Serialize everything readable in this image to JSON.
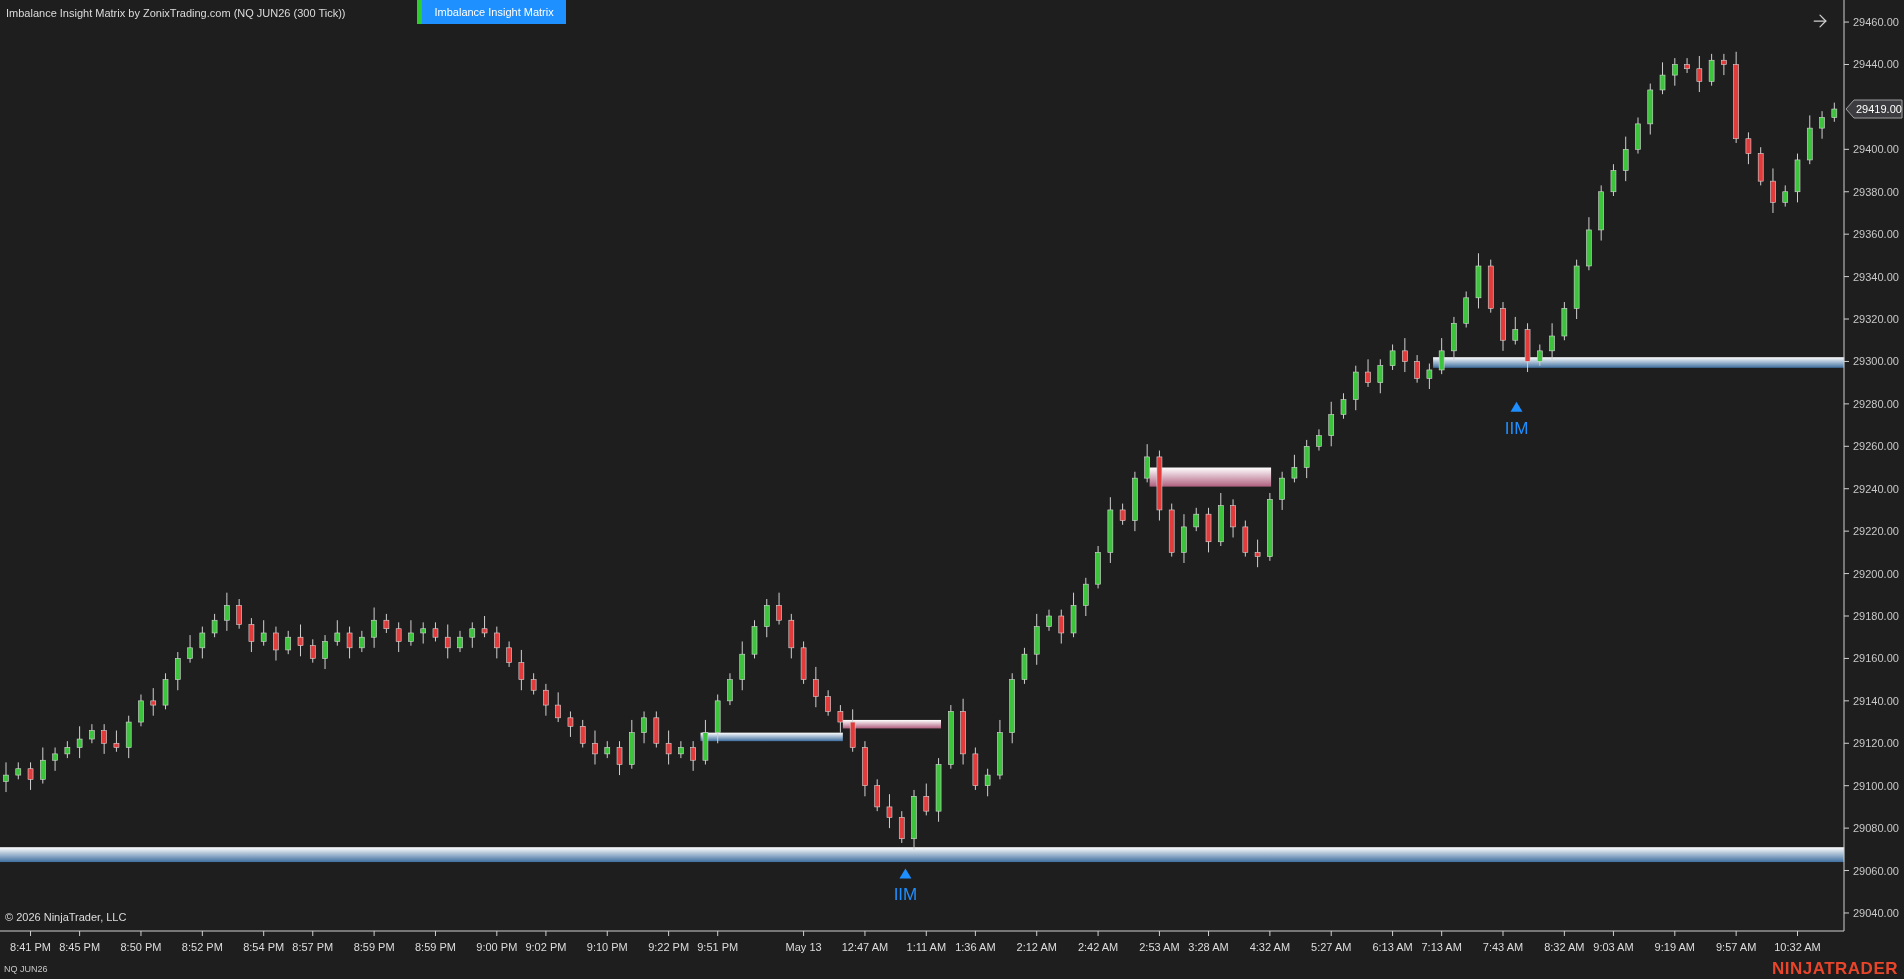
{
  "header": {
    "title": "Imbalance Insight Matrix by ZonixTrading.com (NQ JUN26 (300 Tick))",
    "indicator_button": "Imbalance Insight Matrix"
  },
  "chart": {
    "current_price": "29419.00",
    "copyright": "© 2026 NinjaTrader, LLC",
    "zones": [
      {
        "kind": "bullish"
      },
      {
        "kind": "bullish"
      },
      {
        "kind": "bearish"
      },
      {
        "kind": "bearish"
      },
      {
        "kind": "bullish"
      }
    ],
    "markers": [
      {
        "label": "IIM"
      },
      {
        "label": "IIM"
      }
    ],
    "chart_data": {
      "type": "candlestick",
      "ylim": [
        29031.5,
        29470.4
      ],
      "categories": [
        null,
        null,
        "8:41 PM",
        null,
        null,
        null,
        "8:45 PM",
        null,
        null,
        null,
        null,
        "8:50 PM",
        null,
        null,
        null,
        null,
        "8:52 PM",
        null,
        null,
        null,
        null,
        "8:54 PM",
        null,
        null,
        null,
        "8:57 PM",
        null,
        null,
        null,
        null,
        "8:59 PM",
        null,
        null,
        null,
        null,
        "8:59 PM",
        null,
        null,
        null,
        null,
        "9:00 PM",
        null,
        null,
        null,
        "9:02 PM",
        null,
        null,
        null,
        null,
        "9:10 PM",
        null,
        null,
        null,
        null,
        "9:22 PM",
        null,
        null,
        null,
        "9:51 PM",
        null,
        null,
        null,
        null,
        null,
        null,
        "May 13",
        null,
        null,
        null,
        null,
        "12:47 AM",
        null,
        null,
        null,
        null,
        "1:11 AM",
        null,
        null,
        null,
        "1:36 AM",
        null,
        null,
        null,
        null,
        "2:12 AM",
        null,
        null,
        null,
        null,
        "2:42 AM",
        null,
        null,
        null,
        null,
        "2:53 AM",
        null,
        null,
        null,
        "3:28 AM",
        null,
        null,
        null,
        null,
        "4:32 AM",
        null,
        null,
        null,
        null,
        "5:27 AM",
        null,
        null,
        null,
        null,
        "6:13 AM",
        null,
        null,
        null,
        "7:13 AM",
        null,
        null,
        null,
        null,
        "7:43 AM",
        null,
        null,
        null,
        null,
        "8:32 AM",
        null,
        null,
        null,
        "9:03 AM",
        null,
        null,
        null,
        null,
        "9:19 AM",
        null,
        null,
        null,
        null,
        "9:57 AM",
        null,
        null,
        null,
        null,
        "10:32 AM",
        null,
        null,
        null
      ],
      "ohlc": [
        [
          29102,
          29111,
          29097,
          29105
        ],
        [
          29105,
          29111,
          29103,
          29108
        ],
        [
          29108,
          29111,
          29098,
          29103
        ],
        [
          29103,
          29118,
          29101,
          29112
        ],
        [
          29112,
          29118,
          29107,
          29115
        ],
        [
          29115,
          29121,
          29113,
          29118
        ],
        [
          29118,
          29128,
          29113,
          29122
        ],
        [
          29122,
          29129,
          29120,
          29126
        ],
        [
          29126,
          29129,
          29115,
          29120
        ],
        [
          29120,
          29126,
          29116,
          29118
        ],
        [
          29118,
          29133,
          29113,
          29130
        ],
        [
          29130,
          29143,
          29128,
          29140
        ],
        [
          29140,
          29146,
          29133,
          29138
        ],
        [
          29138,
          29153,
          29136,
          29150
        ],
        [
          29150,
          29163,
          29145,
          29160
        ],
        [
          29160,
          29171,
          29158,
          29165
        ],
        [
          29165,
          29175,
          29160,
          29172
        ],
        [
          29172,
          29181,
          29170,
          29178
        ],
        [
          29178,
          29191,
          29173,
          29185
        ],
        [
          29185,
          29188,
          29174,
          29176
        ],
        [
          29176,
          29179,
          29163,
          29168
        ],
        [
          29168,
          29178,
          29166,
          29172
        ],
        [
          29172,
          29175,
          29159,
          29164
        ],
        [
          29164,
          29173,
          29162,
          29170
        ],
        [
          29170,
          29176,
          29161,
          29166
        ],
        [
          29166,
          29169,
          29158,
          29160
        ],
        [
          29160,
          29171,
          29155,
          29168
        ],
        [
          29168,
          29178,
          29166,
          29172
        ],
        [
          29172,
          29175,
          29160,
          29165
        ],
        [
          29165,
          29173,
          29163,
          29170
        ],
        [
          29170,
          29184,
          29165,
          29178
        ],
        [
          29178,
          29181,
          29172,
          29174
        ],
        [
          29174,
          29177,
          29163,
          29168
        ],
        [
          29168,
          29178,
          29166,
          29172
        ],
        [
          29172,
          29177,
          29167,
          29174
        ],
        [
          29174,
          29177,
          29168,
          29170
        ],
        [
          29170,
          29176,
          29160,
          29165
        ],
        [
          29165,
          29173,
          29163,
          29170
        ],
        [
          29170,
          29177,
          29165,
          29174
        ],
        [
          29174,
          29180,
          29170,
          29172
        ],
        [
          29172,
          29175,
          29160,
          29165
        ],
        [
          29165,
          29168,
          29156,
          29158
        ],
        [
          29158,
          29164,
          29145,
          29150
        ],
        [
          29150,
          29153,
          29143,
          29145
        ],
        [
          29145,
          29148,
          29133,
          29138
        ],
        [
          29138,
          29144,
          29130,
          29132
        ],
        [
          29132,
          29135,
          29123,
          29128
        ],
        [
          29128,
          29131,
          29118,
          29120
        ],
        [
          29120,
          29126,
          29110,
          29115
        ],
        [
          29115,
          29121,
          29113,
          29118
        ],
        [
          29118,
          29121,
          29105,
          29110
        ],
        [
          29110,
          29131,
          29108,
          29125
        ],
        [
          29125,
          29135,
          29120,
          29132
        ],
        [
          29132,
          29135,
          29118,
          29120
        ],
        [
          29120,
          29126,
          29110,
          29115
        ],
        [
          29115,
          29121,
          29113,
          29118
        ],
        [
          29118,
          29121,
          29107,
          29112
        ],
        [
          29112,
          29131,
          29110,
          29125
        ],
        [
          29125,
          29143,
          29120,
          29140
        ],
        [
          29140,
          29153,
          29138,
          29150
        ],
        [
          29150,
          29168,
          29145,
          29162
        ],
        [
          29162,
          29178,
          29160,
          29175
        ],
        [
          29175,
          29188,
          29170,
          29185
        ],
        [
          29185,
          29191,
          29176,
          29178
        ],
        [
          29178,
          29181,
          29160,
          29165
        ],
        [
          29165,
          29168,
          29148,
          29150
        ],
        [
          29150,
          29156,
          29137,
          29142
        ],
        [
          29142,
          29145,
          29133,
          29135
        ],
        [
          29135,
          29138,
          29125,
          29130
        ],
        [
          29130,
          29136,
          29116,
          29118
        ],
        [
          29118,
          29121,
          29095,
          29100
        ],
        [
          29100,
          29103,
          29088,
          29090
        ],
        [
          29090,
          29096,
          29080,
          29085
        ],
        [
          29085,
          29088,
          29073,
          29075
        ],
        [
          29075,
          29098,
          29070,
          29095
        ],
        [
          29095,
          29101,
          29086,
          29088
        ],
        [
          29088,
          29113,
          29083,
          29110
        ],
        [
          29110,
          29138,
          29108,
          29135
        ],
        [
          29135,
          29141,
          29110,
          29115
        ],
        [
          29115,
          29118,
          29098,
          29100
        ],
        [
          29100,
          29108,
          29095,
          29105
        ],
        [
          29105,
          29131,
          29103,
          29125
        ],
        [
          29125,
          29153,
          29120,
          29150
        ],
        [
          29150,
          29165,
          29148,
          29162
        ],
        [
          29162,
          29181,
          29157,
          29175
        ],
        [
          29175,
          29183,
          29173,
          29180
        ],
        [
          29180,
          29183,
          29167,
          29172
        ],
        [
          29172,
          29191,
          29170,
          29185
        ],
        [
          29185,
          29198,
          29180,
          29195
        ],
        [
          29195,
          29213,
          29193,
          29210
        ],
        [
          29210,
          29236,
          29205,
          29230
        ],
        [
          29230,
          29233,
          29223,
          29225
        ],
        [
          29225,
          29248,
          29220,
          29245
        ],
        [
          29245,
          29261,
          29243,
          29255
        ],
        [
          29255,
          29258,
          29225,
          29230
        ],
        [
          29230,
          29233,
          29208,
          29210
        ],
        [
          29210,
          29228,
          29205,
          29222
        ],
        [
          29222,
          29231,
          29220,
          29228
        ],
        [
          29228,
          29231,
          29210,
          29215
        ],
        [
          29215,
          29238,
          29213,
          29232
        ],
        [
          29232,
          29235,
          29217,
          29222
        ],
        [
          29222,
          29225,
          29208,
          29210
        ],
        [
          29210,
          29216,
          29203,
          29208
        ],
        [
          29208,
          29238,
          29206,
          29235
        ],
        [
          29235,
          29248,
          29230,
          29245
        ],
        [
          29245,
          29256,
          29243,
          29250
        ],
        [
          29250,
          29263,
          29245,
          29260
        ],
        [
          29260,
          29268,
          29258,
          29265
        ],
        [
          29265,
          29281,
          29260,
          29275
        ],
        [
          29275,
          29285,
          29273,
          29282
        ],
        [
          29282,
          29298,
          29277,
          29295
        ],
        [
          29295,
          29301,
          29288,
          29290
        ],
        [
          29290,
          29301,
          29285,
          29298
        ],
        [
          29298,
          29308,
          29296,
          29305
        ],
        [
          29305,
          29311,
          29295,
          29300
        ],
        [
          29300,
          29303,
          29290,
          29292
        ],
        [
          29292,
          29299,
          29287,
          29296
        ],
        [
          29296,
          29311,
          29294,
          29305
        ],
        [
          29305,
          29321,
          29300,
          29318
        ],
        [
          29318,
          29333,
          29316,
          29330
        ],
        [
          29330,
          29351,
          29325,
          29345
        ],
        [
          29345,
          29348,
          29323,
          29325
        ],
        [
          29325,
          29328,
          29305,
          29310
        ],
        [
          29310,
          29321,
          29308,
          29315
        ],
        [
          29315,
          29318,
          29295,
          29300
        ],
        [
          29300,
          29308,
          29298,
          29305
        ],
        [
          29305,
          29318,
          29300,
          29312
        ],
        [
          29312,
          29328,
          29310,
          29325
        ],
        [
          29325,
          29348,
          29320,
          29345
        ],
        [
          29345,
          29368,
          29343,
          29362
        ],
        [
          29362,
          29383,
          29357,
          29380
        ],
        [
          29380,
          29393,
          29378,
          29390
        ],
        [
          29390,
          29406,
          29385,
          29400
        ],
        [
          29400,
          29415,
          29398,
          29412
        ],
        [
          29412,
          29431,
          29407,
          29428
        ],
        [
          29428,
          29441,
          29426,
          29435
        ],
        [
          29435,
          29443,
          29430,
          29440
        ],
        [
          29440,
          29443,
          29436,
          29438
        ],
        [
          29438,
          29444,
          29427,
          29432
        ],
        [
          29432,
          29445,
          29430,
          29442
        ],
        [
          29442,
          29445,
          29435,
          29440
        ],
        [
          29440,
          29446,
          29403,
          29405
        ],
        [
          29405,
          29408,
          29393,
          29398
        ],
        [
          29398,
          29401,
          29383,
          29385
        ],
        [
          29385,
          29391,
          29370,
          29375
        ],
        [
          29375,
          29383,
          29373,
          29380
        ],
        [
          29380,
          29398,
          29375,
          29395
        ],
        [
          29395,
          29416,
          29393,
          29410
        ],
        [
          29410,
          29418,
          29405,
          29415
        ],
        [
          29415,
          29422,
          29413,
          29419
        ]
      ],
      "yticks": [
        {
          "value": 29460,
          "label": "29460.00"
        },
        {
          "value": 29440,
          "label": "29440.00"
        },
        {
          "value": 29400,
          "label": "29400.00"
        },
        {
          "value": 29380,
          "label": "29380.00"
        },
        {
          "value": 29360,
          "label": "29360.00"
        },
        {
          "value": 29340,
          "label": "29340.00"
        },
        {
          "value": 29320,
          "label": "29320.00"
        },
        {
          "value": 29300,
          "label": "29300.00"
        },
        {
          "value": 29280,
          "label": "29280.00"
        },
        {
          "value": 29260,
          "label": "29260.00"
        },
        {
          "value": 29240,
          "label": "29240.00"
        },
        {
          "value": 29220,
          "label": "29220.00"
        },
        {
          "value": 29200,
          "label": "29200.00"
        },
        {
          "value": 29180,
          "label": "29180.00"
        },
        {
          "value": 29160,
          "label": "29160.00"
        },
        {
          "value": 29140,
          "label": "29140.00"
        },
        {
          "value": 29120,
          "label": "29120.00"
        },
        {
          "value": 29100,
          "label": "29100.00"
        },
        {
          "value": 29080,
          "label": "29080.00"
        },
        {
          "value": 29060,
          "label": "29060.00"
        },
        {
          "value": 29040,
          "label": "29040.00"
        }
      ]
    }
  },
  "footer": {
    "instrument": "NQ JUN26",
    "logo": "NINJATRADER"
  }
}
